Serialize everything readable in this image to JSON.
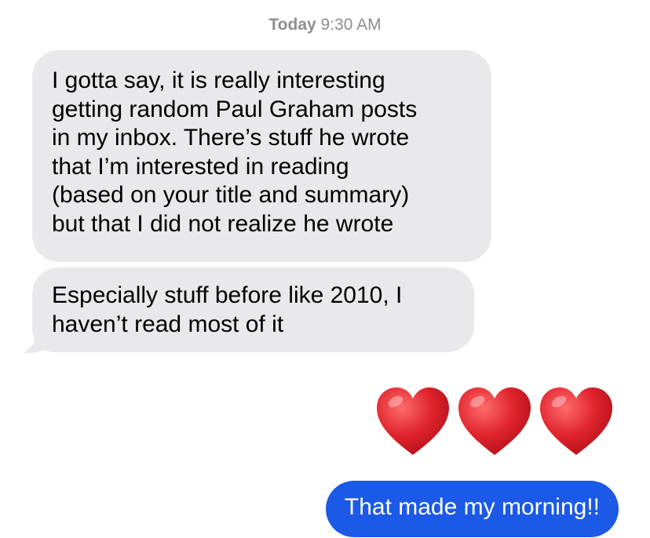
{
  "timestamp": {
    "day": "Today",
    "time": "9:30 AM"
  },
  "messages": [
    {
      "sender": "incoming",
      "lines": [
        "I gotta say, it is really interesting",
        "getting random Paul Graham posts",
        "in my inbox. There’s stuff he wrote",
        "that I’m interested in reading",
        "(based on your title and summary)",
        "but that I did not realize he wrote"
      ]
    },
    {
      "sender": "incoming",
      "lines": [
        "Especially stuff before like 2010, I",
        "haven’t read most of it"
      ]
    },
    {
      "sender": "outgoing",
      "emoji": [
        "heart-icon",
        "heart-icon",
        "heart-icon"
      ],
      "emoji_color": "#e0242d"
    },
    {
      "sender": "outgoing",
      "text": "That made my morning!!"
    }
  ],
  "colors": {
    "incoming_bubble": "#e9e9eb",
    "outgoing_bubble": "#1b59e6",
    "timestamp_text": "#8e8e93"
  }
}
